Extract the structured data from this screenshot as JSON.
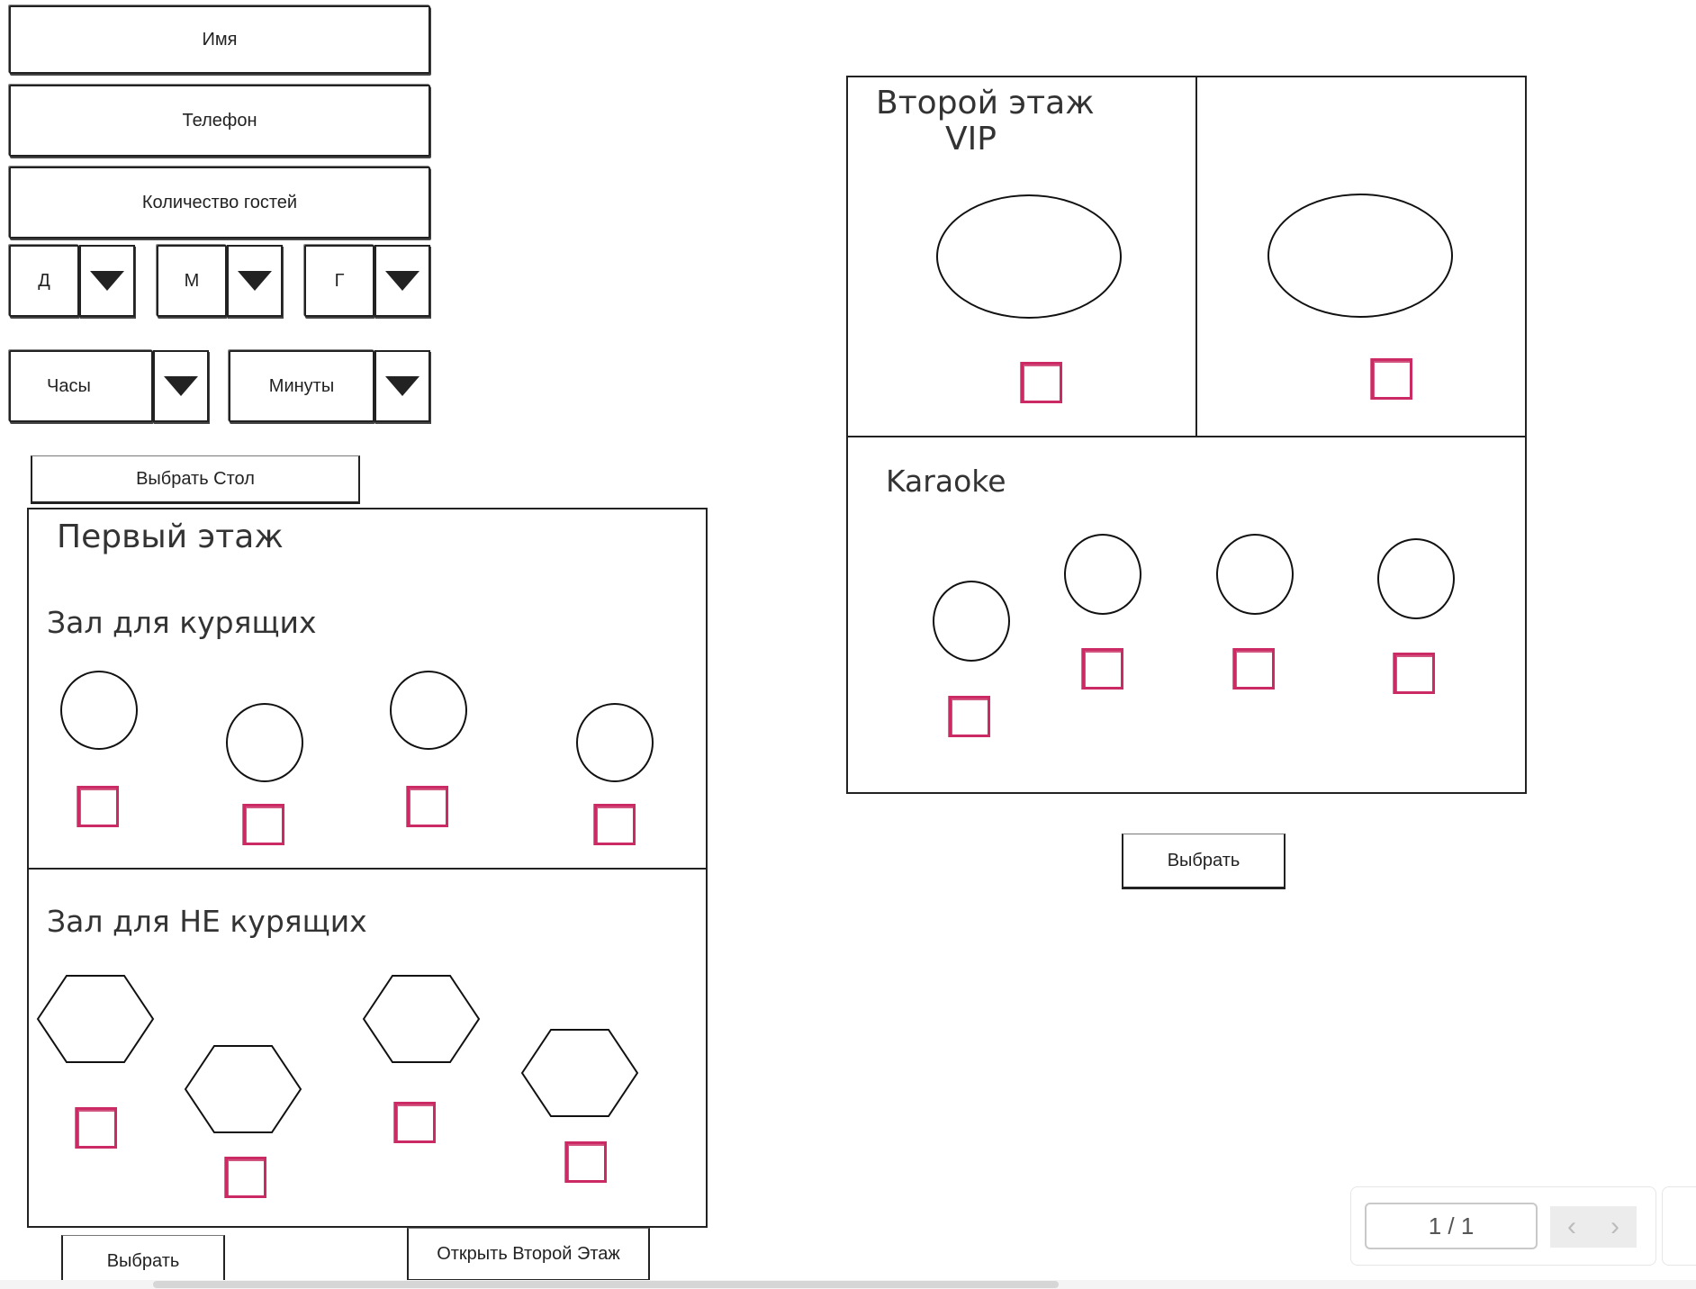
{
  "form": {
    "name_placeholder": "Имя",
    "phone_placeholder": "Телефон",
    "guests_placeholder": "Количество гостей",
    "day_label": "Д",
    "month_label": "М",
    "year_label": "Г",
    "hours_label": "Часы",
    "minutes_label": "Минуты",
    "choose_table_label": "Выбрать Стол"
  },
  "first_floor": {
    "title": "Первый этаж",
    "smoking_title": "Зал для курящих",
    "nonsmoking_title": "Зал для НЕ курящих",
    "select_label": "Выбрать",
    "open_second_label": "Открыть Второй Этаж"
  },
  "second_floor": {
    "title": "Второй этаж",
    "subtitle": "VIP",
    "karaoke_title": "Karaoke",
    "select_label": "Выбрать"
  },
  "pager": {
    "page_indicator": "1 / 1",
    "prev_icon": "chevron-left-icon",
    "next_icon": "chevron-right-icon"
  },
  "colors": {
    "checkbox": "#cc2a64",
    "outline": "#222222"
  }
}
